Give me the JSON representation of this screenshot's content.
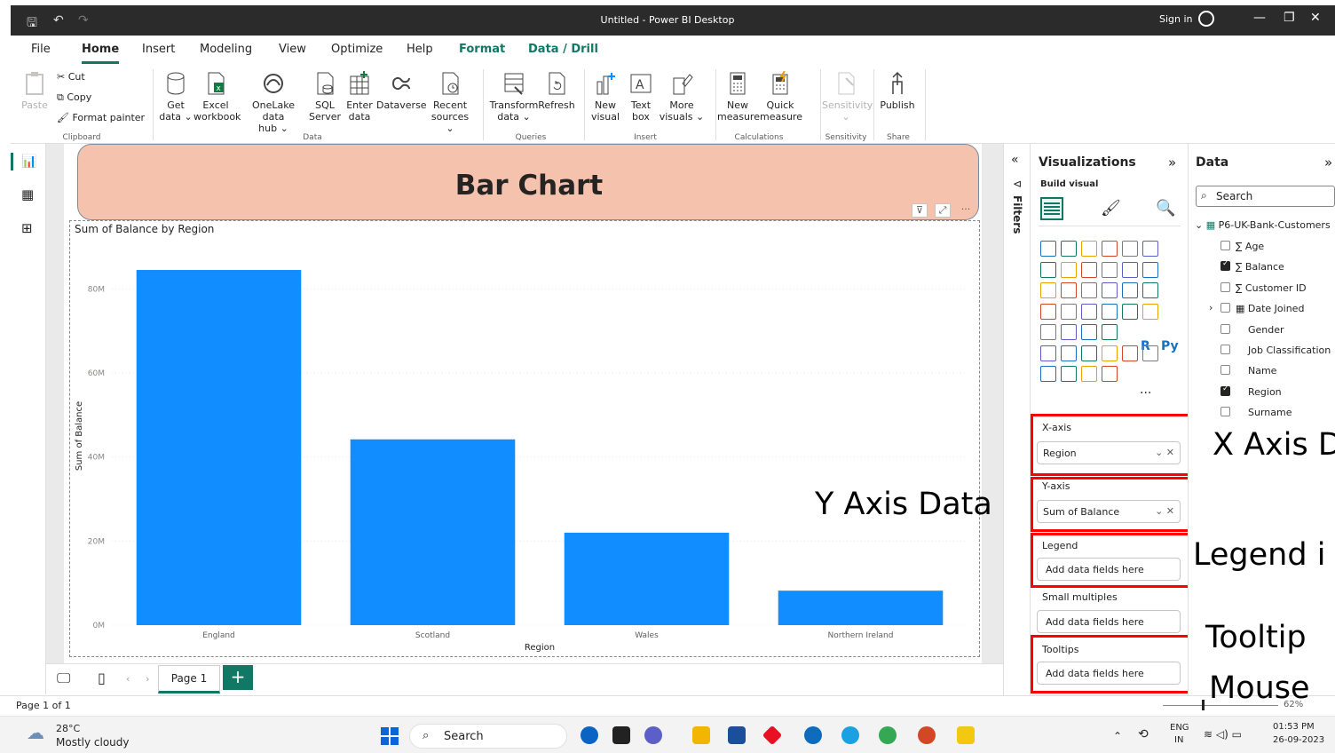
{
  "titlebar": {
    "title": "Untitled - Power BI Desktop",
    "sign_in": "Sign in"
  },
  "menu": [
    "File",
    "Home",
    "Insert",
    "Modeling",
    "View",
    "Optimize",
    "Help",
    "Format",
    "Data / Drill"
  ],
  "ribbon": {
    "clipboard": {
      "paste": "Paste",
      "cut": "Cut",
      "copy": "Copy",
      "format_painter": "Format painter",
      "label": "Clipboard"
    },
    "data": {
      "get_data": [
        "Get",
        "data ⌄"
      ],
      "excel": [
        "Excel",
        "workbook"
      ],
      "onelake": [
        "OneLake data",
        "hub ⌄"
      ],
      "sql": [
        "SQL",
        "Server"
      ],
      "enter": [
        "Enter",
        "data"
      ],
      "dataverse": [
        "Dataverse",
        ""
      ],
      "recent": [
        "Recent",
        "sources ⌄"
      ],
      "label": "Data"
    },
    "queries": {
      "transform": [
        "Transform",
        "data ⌄"
      ],
      "refresh": [
        "Refresh",
        ""
      ],
      "label": "Queries"
    },
    "insert": {
      "new_visual": [
        "New",
        "visual"
      ],
      "text_box": [
        "Text",
        "box"
      ],
      "more_visuals": [
        "More",
        "visuals ⌄"
      ],
      "label": "Insert"
    },
    "calculations": {
      "new_measure": [
        "New",
        "measure"
      ],
      "quick_measure": [
        "Quick",
        "measure"
      ],
      "label": "Calculations"
    },
    "sensitivity": {
      "sensitivity": [
        "Sensitivity",
        "⌄"
      ],
      "label": "Sensitivity"
    },
    "share": {
      "publish": "Publish",
      "label": "Share"
    }
  },
  "banner": {
    "title": "Bar Chart"
  },
  "chart_data": {
    "type": "bar",
    "title": "Sum of Balance by Region",
    "xlabel": "Region",
    "ylabel": "Sum of Balance",
    "categories": [
      "England",
      "Scotland",
      "Wales",
      "Northern Ireland"
    ],
    "values": [
      84.5,
      44.2,
      22.0,
      8.2
    ],
    "ylim": [
      0,
      90
    ],
    "yticks": [
      0,
      20,
      40,
      60,
      80
    ],
    "ytick_labels": [
      "0M",
      "20M",
      "40M",
      "60M",
      "80M"
    ],
    "color": "#118dff",
    "grid": true
  },
  "pages": {
    "tab": "Page 1",
    "add": "+"
  },
  "status": {
    "page_count": "Page 1 of 1",
    "zoom": "62%"
  },
  "filters": {
    "label": "Filters"
  },
  "visualizations": {
    "title": "Visualizations",
    "build_visual": "Build visual",
    "wells": [
      {
        "label": "X-axis",
        "value": "Region"
      },
      {
        "label": "Y-axis",
        "value": "Sum of Balance"
      },
      {
        "label": "Legend",
        "placeholder": "Add data fields here"
      },
      {
        "label": "Small multiples",
        "placeholder": "Add data fields here"
      },
      {
        "label": "Tooltips",
        "placeholder": "Add data fields here"
      }
    ],
    "viz_text_icons": {
      "r": "R",
      "py": "Py",
      "more": "···"
    }
  },
  "data_pane": {
    "title": "Data",
    "search_placeholder": "Search",
    "table": "P6-UK-Bank-Customers",
    "fields": [
      {
        "name": "Age",
        "checked": false,
        "sigma": true
      },
      {
        "name": "Balance",
        "checked": true,
        "sigma": true
      },
      {
        "name": "Customer ID",
        "checked": false,
        "sigma": true
      },
      {
        "name": "Date Joined",
        "checked": false,
        "sigma": false,
        "expandable": true
      },
      {
        "name": "Gender",
        "checked": false,
        "sigma": false
      },
      {
        "name": "Job Classification",
        "checked": false,
        "sigma": false
      },
      {
        "name": "Name",
        "checked": false,
        "sigma": false
      },
      {
        "name": "Region",
        "checked": true,
        "sigma": false
      },
      {
        "name": "Surname",
        "checked": false,
        "sigma": false
      }
    ]
  },
  "annotations": {
    "x_axis": "X Axis D",
    "y_axis": "Y Axis Data",
    "legend": "Legend i",
    "tooltip": "Tooltip",
    "mouse": "Mouse"
  },
  "taskbar": {
    "weather_temp": "28°C",
    "weather_desc": "Mostly cloudy",
    "search": "Search",
    "lang": "ENG",
    "region": "IN",
    "time": "01:53 PM",
    "date": "26-09-2023"
  },
  "colors": {
    "accent": "#117865",
    "bar": "#118dff",
    "banner": "#f5c3ad",
    "highlight": "#ff0000"
  }
}
